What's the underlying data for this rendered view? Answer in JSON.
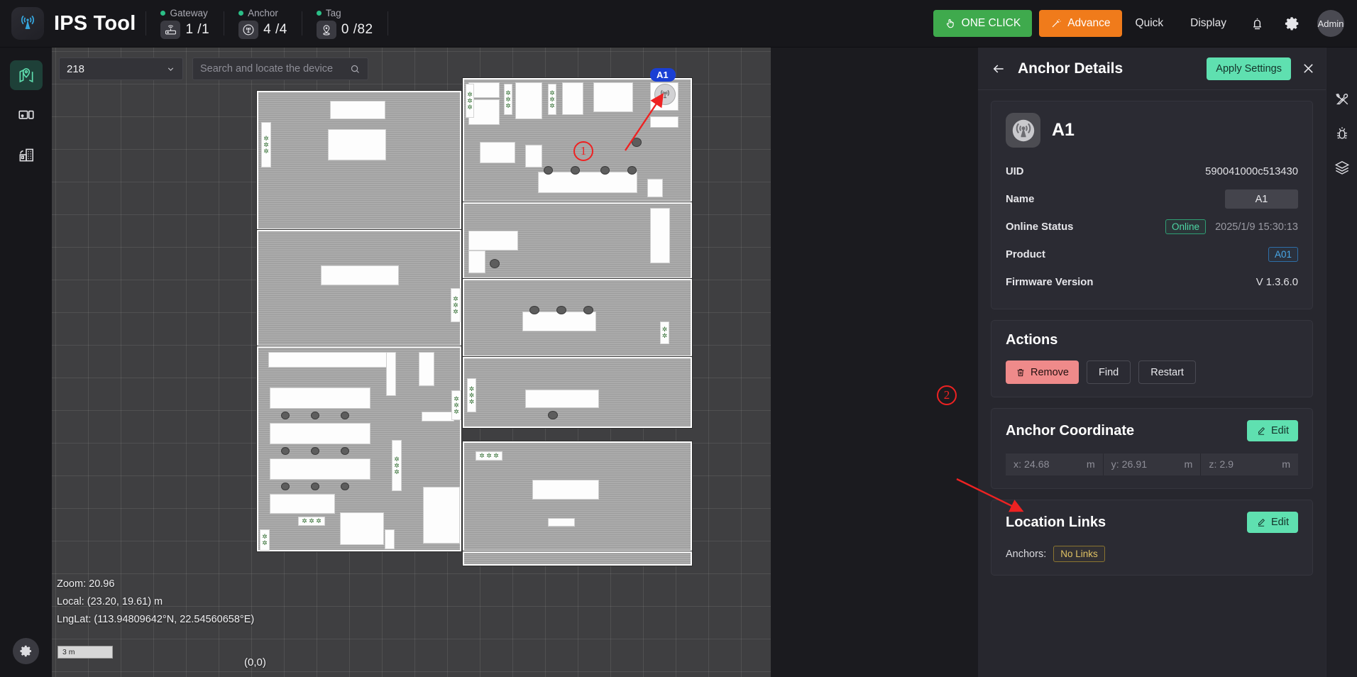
{
  "header": {
    "brand": "IPS Tool",
    "logo_icon": "antenna-tower-icon",
    "stats": [
      {
        "label": "Gateway",
        "value": "1 /1",
        "icon": "router-icon"
      },
      {
        "label": "Anchor",
        "value": "4 /4",
        "icon": "anchor-antenna-icon"
      },
      {
        "label": "Tag",
        "value": "0 /82",
        "icon": "tag-pin-icon"
      }
    ],
    "one_click_label": "ONE CLICK",
    "advance_label": "Advance",
    "quick_label": "Quick",
    "display_label": "Display",
    "alarm_icon": "alarm-bell-icon",
    "settings_icon": "gear-icon",
    "user_label": "Admin",
    "colors": {
      "one_click": "#3faa4d",
      "advance": "#f07b1b",
      "status_dot": "#2bbf87"
    }
  },
  "sidebar": {
    "items": [
      {
        "name": "map-view",
        "icon": "location-map-icon",
        "active": true
      },
      {
        "name": "device-view",
        "icon": "device-monitor-icon",
        "active": false
      },
      {
        "name": "building-view",
        "icon": "building-icon",
        "active": false
      }
    ],
    "settings_icon": "gear-icon"
  },
  "map": {
    "floor_select_value": "218",
    "floor_select_icon": "chevron-down-icon",
    "search_placeholder": "Search and locate the device",
    "search_value": "",
    "search_icon": "search-icon",
    "readout": {
      "zoom_label": "Zoom:",
      "zoom_value": "20.96",
      "local_label": "Local:",
      "local_value": "(23.20,  19.61)  m",
      "lnglat_label": "LngLat:",
      "lnglat_value": "(113.94809642°N,  22.54560658°E)"
    },
    "scale_bar": "3 m",
    "origin_label": "(0,0)",
    "anchor_pin_label": "A1",
    "anchor_pin_icon": "anchor-antenna-icon",
    "annotations": [
      {
        "id": "1",
        "label": "1"
      },
      {
        "id": "2",
        "label": "2"
      }
    ]
  },
  "panel": {
    "back_icon": "arrow-left-icon",
    "title": "Anchor Details",
    "apply_label": "Apply Settings",
    "close_icon": "close-icon",
    "device": {
      "icon": "anchor-antenna-icon",
      "name": "A1"
    },
    "details": [
      {
        "label": "UID",
        "value": "590041000c513430"
      },
      {
        "label": "Name",
        "value": "A1"
      },
      {
        "label": "Online Status",
        "value": "Online",
        "timestamp": "2025/1/9 15:30:13"
      },
      {
        "label": "Product",
        "value": "A01"
      },
      {
        "label": "Firmware Version",
        "value": "V 1.3.6.0"
      }
    ],
    "actions": {
      "title": "Actions",
      "remove_label": "Remove",
      "remove_icon": "trash-icon",
      "find_label": "Find",
      "restart_label": "Restart"
    },
    "coordinate": {
      "title": "Anchor Coordinate",
      "edit_label": "Edit",
      "edit_icon": "pencil-icon",
      "x": "x: 24.68",
      "x_unit": "m",
      "y": "y: 26.91",
      "y_unit": "m",
      "z": "z: 2.9",
      "z_unit": "m"
    },
    "location_links": {
      "title": "Location Links",
      "edit_label": "Edit",
      "edit_icon": "pencil-icon",
      "anchors_label": "Anchors:",
      "anchors_value": "No Links"
    }
  },
  "right_rail": {
    "items": [
      {
        "name": "tools",
        "icon": "tools-wrench-icon"
      },
      {
        "name": "debug",
        "icon": "bug-icon"
      },
      {
        "name": "layers",
        "icon": "layers-icon"
      }
    ]
  }
}
